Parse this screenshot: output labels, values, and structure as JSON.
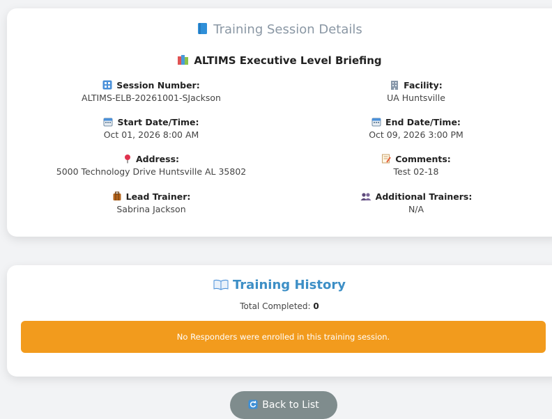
{
  "panel": {
    "title": "Training Session Details",
    "session_title": "ALTIMS Executive Level Briefing"
  },
  "fields": {
    "session_number": {
      "label": "Session Number:",
      "value": "ALTIMS-ELB-20261001-SJackson"
    },
    "facility": {
      "label": "Facility:",
      "value": "UA Huntsville"
    },
    "start": {
      "label": "Start Date/Time:",
      "value": "Oct 01, 2026 8:00 AM"
    },
    "end": {
      "label": "End Date/Time:",
      "value": "Oct 09, 2026 3:00 PM"
    },
    "address": {
      "label": "Address:",
      "value": "5000 Technology Drive Huntsville AL 35802"
    },
    "comments": {
      "label": "Comments:",
      "value": "Test 02-18"
    },
    "lead_trainer": {
      "label": "Lead Trainer:",
      "value": "Sabrina Jackson"
    },
    "additional_trainers": {
      "label": "Additional Trainers:",
      "value": "N/A"
    }
  },
  "history": {
    "title": "Training History",
    "completed_label": "Total Completed:",
    "completed_count": "0",
    "alert": "No Responders were enrolled in this training session."
  },
  "actions": {
    "back_label": "Back to List"
  },
  "icons": {
    "book": "book-icon",
    "books": "books-icon",
    "numbers": "input-numbers-icon",
    "building": "office-building-icon",
    "calendar": "calendar-icon",
    "pin": "round-pushpin-icon",
    "memo": "memo-icon",
    "briefcase": "luggage-icon",
    "people": "busts-in-silhouette-icon",
    "open_book": "open-book-icon",
    "refresh": "refresh-icon"
  },
  "colors": {
    "accent_blue": "#3d8fc6",
    "alert_orange": "#f29b1d",
    "button_gray": "#7f8c8d"
  }
}
